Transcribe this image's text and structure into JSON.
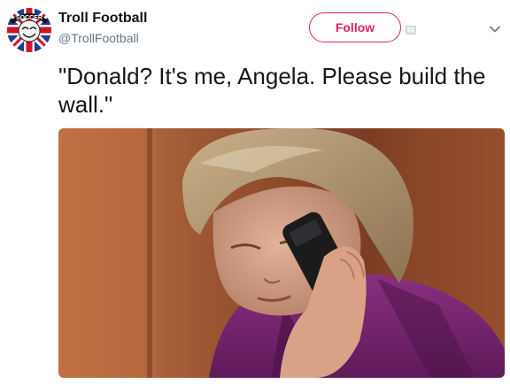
{
  "tweet": {
    "author_name": "Troll Football",
    "author_handle": "@TrollFootball",
    "follow_label": "Follow",
    "text": "\"Donald? It's me, Angela. Please build the wall.\""
  },
  "avatar": {
    "badge_text": "SOCCER"
  },
  "icons": {
    "external": "media-card-icon",
    "menu": "chevron-down-icon"
  },
  "colors": {
    "accent": "#e0245e",
    "text": "#14171a",
    "secondary": "#657786"
  }
}
